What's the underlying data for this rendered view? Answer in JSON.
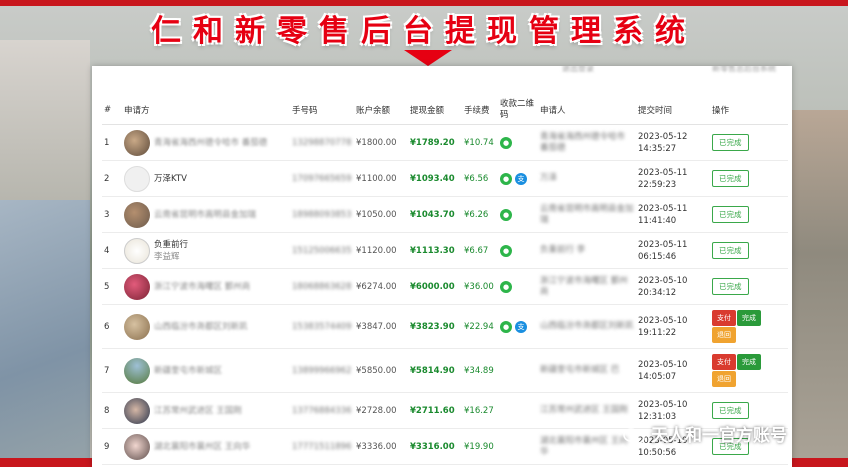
{
  "title": "仁和新零售后台提现管理系统",
  "watermark": "天人和一官方账号",
  "colors": {
    "brand_red": "#e60012",
    "green": "#1a8a2e",
    "wechat": "#2db54a",
    "alipay": "#1a8fe0",
    "pay_btn": "#d93b2f",
    "back_btn": "#f0a330"
  },
  "table": {
    "headers": {
      "index": "#",
      "applicant": "申请方",
      "phone": "手号码",
      "balance": "账户余额",
      "amount": "提现金额",
      "fee": "手续费",
      "qr": "收款二维码",
      "requester": "申请人",
      "time": "提交时间",
      "op": "操作"
    },
    "rows": [
      {
        "index": "1",
        "name": "青海省海西州德令哈市 番茄德",
        "sub": "",
        "phone": "13298870778",
        "balance": "¥1800.00",
        "amount": "¥1789.20",
        "fee": "¥10.74",
        "qr": [
          "wechat"
        ],
        "requester": "青海省海西州德令哈市 番茄德",
        "date": "2023-05-12",
        "clock": "14:35:27",
        "ops": [
          "已完成"
        ]
      },
      {
        "index": "2",
        "name": "万泽KTV",
        "sub": "",
        "phone": "17097665659",
        "balance": "¥1100.00",
        "amount": "¥1093.40",
        "fee": "¥6.56",
        "qr": [
          "wechat",
          "alipay"
        ],
        "requester": "万泽",
        "date": "2023-05-11",
        "clock": "22:59:23",
        "ops": [
          "已完成"
        ]
      },
      {
        "index": "3",
        "name": "云南省昆明市嵩明县金加瑞",
        "sub": "",
        "phone": "18988093853",
        "balance": "¥1050.00",
        "amount": "¥1043.70",
        "fee": "¥6.26",
        "qr": [
          "wechat"
        ],
        "requester": "云南省昆明市嵩明县金加瑞",
        "date": "2023-05-11",
        "clock": "11:41:40",
        "ops": [
          "已完成"
        ]
      },
      {
        "index": "4",
        "name": "负重前行",
        "sub": "李益辉",
        "phone": "15125006635",
        "balance": "¥1120.00",
        "amount": "¥1113.30",
        "fee": "¥6.67",
        "qr": [
          "wechat"
        ],
        "requester": "负重前行 李",
        "date": "2023-05-11",
        "clock": "06:15:46",
        "ops": [
          "已完成"
        ]
      },
      {
        "index": "5",
        "name": "浙江宁波市海曙区 鄞州商",
        "sub": "",
        "phone": "18068863628",
        "balance": "¥6274.00",
        "amount": "¥6000.00",
        "fee": "¥36.00",
        "qr": [
          "wechat"
        ],
        "requester": "浙江宁波市海曙区 鄞州商",
        "date": "2023-05-10",
        "clock": "20:34:12",
        "ops": [
          "已完成"
        ]
      },
      {
        "index": "6",
        "name": "山西临汾市尧都区刘新凯",
        "sub": "",
        "phone": "15383574409",
        "balance": "¥3847.00",
        "amount": "¥3823.90",
        "fee": "¥22.94",
        "qr": [
          "wechat",
          "alipay"
        ],
        "requester": "山西临汾市尧都区刘新凯",
        "date": "2023-05-10",
        "clock": "19:11:22",
        "ops": [
          "支付",
          "完成",
          "退回"
        ]
      },
      {
        "index": "7",
        "name": "新疆奎屯市新城区",
        "sub": "",
        "phone": "13899966962",
        "balance": "¥5850.00",
        "amount": "¥5814.90",
        "fee": "¥34.89",
        "qr": [],
        "requester": "新疆奎屯市新城区 巴",
        "date": "2023-05-10",
        "clock": "14:05:07",
        "ops": [
          "支付",
          "完成",
          "退回"
        ]
      },
      {
        "index": "8",
        "name": "江苏常州武进区 王国刚",
        "sub": "",
        "phone": "13776884336",
        "balance": "¥2728.00",
        "amount": "¥2711.60",
        "fee": "¥16.27",
        "qr": [],
        "requester": "江苏常州武进区 王国刚",
        "date": "2023-05-10",
        "clock": "12:31:03",
        "ops": [
          "已完成"
        ]
      },
      {
        "index": "9",
        "name": "湖北襄阳市襄州区 王向华",
        "sub": "",
        "phone": "17771511896",
        "balance": "¥3336.00",
        "amount": "¥3316.00",
        "fee": "¥19.90",
        "qr": [],
        "requester": "湖北襄阳市襄州区 王向华",
        "date": "2023-05-10",
        "clock": "10:50:56",
        "ops": [
          "已完成"
        ]
      }
    ]
  },
  "topstrip": {
    "item1": "退出登录",
    "item2": "新零售总后台系统"
  }
}
